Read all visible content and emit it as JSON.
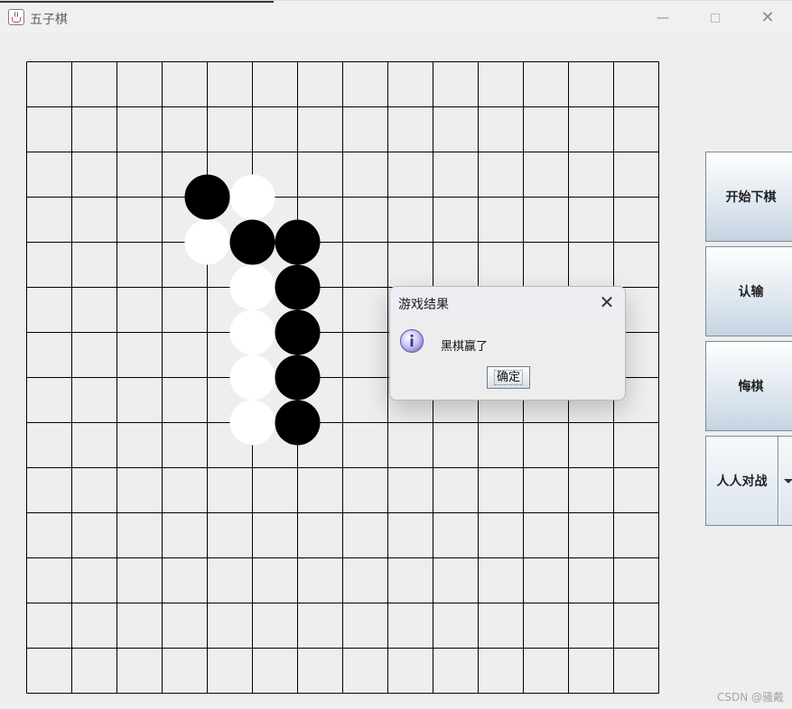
{
  "window": {
    "title": "五子棋",
    "controls": {
      "minimize": "—",
      "close": "✕"
    }
  },
  "board": {
    "size": 15,
    "line_color": "#000000",
    "background": "#eeeeee",
    "stones": [
      {
        "color": "black",
        "col": 4,
        "row": 3
      },
      {
        "color": "white",
        "col": 5,
        "row": 3
      },
      {
        "color": "white",
        "col": 4,
        "row": 4
      },
      {
        "color": "black",
        "col": 5,
        "row": 4
      },
      {
        "color": "black",
        "col": 6,
        "row": 4
      },
      {
        "color": "white",
        "col": 5,
        "row": 5
      },
      {
        "color": "black",
        "col": 6,
        "row": 5
      },
      {
        "color": "white",
        "col": 5,
        "row": 6
      },
      {
        "color": "black",
        "col": 6,
        "row": 6
      },
      {
        "color": "white",
        "col": 5,
        "row": 7
      },
      {
        "color": "black",
        "col": 6,
        "row": 7
      },
      {
        "color": "white",
        "col": 5,
        "row": 8
      },
      {
        "color": "black",
        "col": 6,
        "row": 8
      }
    ]
  },
  "sidebar": {
    "start_label": "开始下棋",
    "resign_label": "认输",
    "undo_label": "悔棋",
    "mode_selected": "人人对战"
  },
  "dialog": {
    "title": "游戏结果",
    "message": "黑棋赢了",
    "ok_label": "确定",
    "icon": "info-icon"
  },
  "watermark": "CSDN @骚戴"
}
